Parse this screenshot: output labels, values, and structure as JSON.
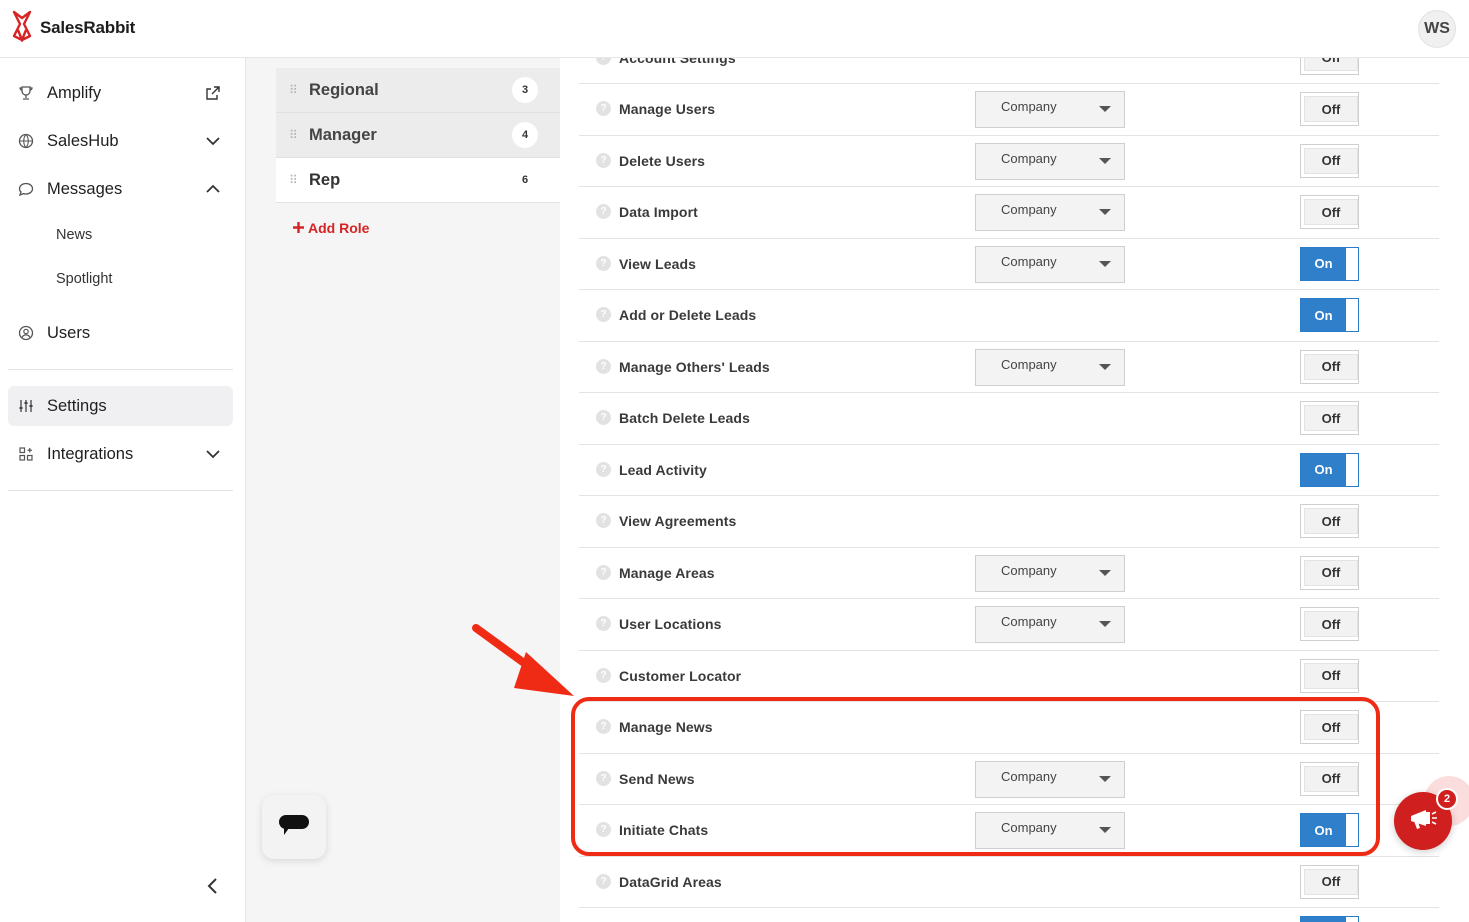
{
  "app": {
    "name": "SalesRabbit",
    "user_initials": "WS",
    "brand_color": "#d62424"
  },
  "sidebar": {
    "items": [
      {
        "label": "Amplify",
        "icon": "trophy-icon",
        "trailing": "external-link-icon"
      },
      {
        "label": "SalesHub",
        "icon": "globe-icon",
        "trailing": "chevron-down-icon"
      },
      {
        "label": "Messages",
        "icon": "chat-bubble-icon",
        "trailing": "chevron-up-icon"
      },
      {
        "label": "Users",
        "icon": "user-circle-icon"
      },
      {
        "label": "Settings",
        "icon": "sliders-icon",
        "active": true
      },
      {
        "label": "Integrations",
        "icon": "grid-plus-icon",
        "trailing": "chevron-down-icon"
      }
    ],
    "messages_sub": [
      "News",
      "Spotlight"
    ]
  },
  "roles": {
    "items": [
      {
        "name": "Regional",
        "count": "3"
      },
      {
        "name": "Manager",
        "count": "4"
      },
      {
        "name": "Rep",
        "count": "6",
        "active": true
      }
    ],
    "add_label": "Add Role"
  },
  "permissions": {
    "toggle_on_label": "On",
    "toggle_off_label": "Off",
    "rows": [
      {
        "label": "Account Settings",
        "scope": null,
        "state": "Off"
      },
      {
        "label": "Manage Users",
        "scope": "Company",
        "state": "Off"
      },
      {
        "label": "Delete Users",
        "scope": "Company",
        "state": "Off"
      },
      {
        "label": "Data Import",
        "scope": "Company",
        "state": "Off"
      },
      {
        "label": "View Leads",
        "scope": "Company",
        "state": "On"
      },
      {
        "label": "Add or Delete Leads",
        "scope": null,
        "state": "On"
      },
      {
        "label": "Manage Others' Leads",
        "scope": "Company",
        "state": "Off"
      },
      {
        "label": "Batch Delete Leads",
        "scope": null,
        "state": "Off"
      },
      {
        "label": "Lead Activity",
        "scope": null,
        "state": "On"
      },
      {
        "label": "View Agreements",
        "scope": null,
        "state": "Off"
      },
      {
        "label": "Manage Areas",
        "scope": "Company",
        "state": "Off"
      },
      {
        "label": "User Locations",
        "scope": "Company",
        "state": "Off"
      },
      {
        "label": "Customer Locator",
        "scope": null,
        "state": "Off"
      },
      {
        "label": "Manage News",
        "scope": null,
        "state": "Off"
      },
      {
        "label": "Send News",
        "scope": "Company",
        "state": "Off"
      },
      {
        "label": "Initiate Chats",
        "scope": "Company",
        "state": "On"
      },
      {
        "label": "DataGrid Areas",
        "scope": null,
        "state": "Off"
      },
      {
        "label": "",
        "scope": null,
        "state": "On"
      }
    ]
  },
  "news_fab": {
    "badge": "2"
  },
  "annotation": {
    "color": "#f02b15"
  }
}
